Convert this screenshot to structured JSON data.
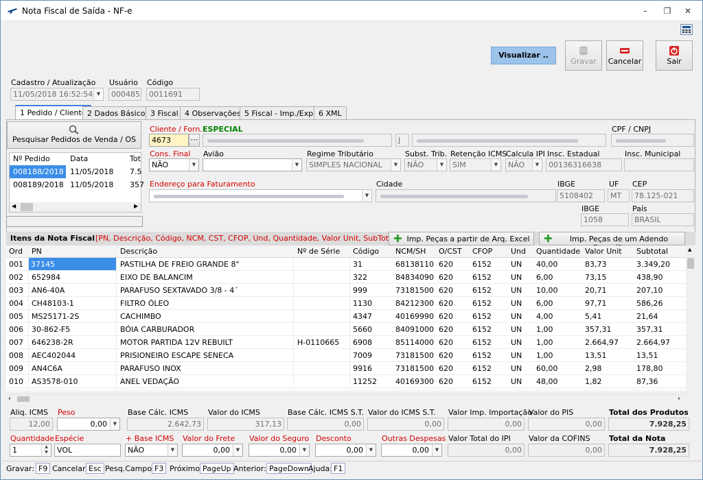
{
  "window": {
    "title": "Nota Fiscal de Saída - NF-e"
  },
  "toolbar": {
    "visualizar": "Visualizar ..",
    "gravar": "Gravar",
    "cancelar": "Cancelar",
    "sair": "Sair"
  },
  "header": {
    "cadastro_label": "Cadastro / Atualização",
    "cadastro_value": "11/05/2018 16:52:54",
    "usuario_label": "Usuário",
    "usuario_value": "0004855",
    "codigo_label": "Código",
    "codigo_value": "0011691"
  },
  "tabs": [
    "1 Pedido / Cliente",
    "2 Dados Básicos",
    "3 Fiscal",
    "4 Observações",
    "5 Fiscal - Imp./Exp.",
    "6 XML"
  ],
  "pedidos": {
    "search_label": "Pesquisar Pedidos de Venda / OS",
    "columns": [
      "Nº Pedido",
      "Data",
      "Tot"
    ],
    "rows": [
      [
        "008188/2018",
        "11/05/2018",
        "7.5"
      ],
      [
        "008189/2018",
        "11/05/2018",
        "357"
      ]
    ]
  },
  "cliente": {
    "cliente_label": "Cliente / Forn.",
    "especial": "ESPECIAL",
    "cliente_code": "4673",
    "uf_short": "J",
    "cpf_label": "CPF / CNPJ",
    "cons_final_label": "Cons. Final",
    "cons_final_value": "NÃO",
    "aviao_label": "Avião",
    "regime_label": "Regime Tributário",
    "regime_value": "SIMPLES NACIONAL",
    "subst_label": "Subst. Trib.",
    "subst_value": "NÃO",
    "retencao_label": "Retenção ICMS",
    "retencao_value": "SIM",
    "calcula_ipi_label": "Calcula IPI",
    "calcula_ipi_value": "NÃO",
    "insc_est_label": "Insc. Estadual",
    "insc_est_value": "00136316638",
    "insc_mun_label": "Insc. Municipal",
    "endereco_label": "Endereço para Faturamento",
    "cidade_label": "Cidade",
    "ibge_label": "IBGE",
    "ibge_value": "5108402",
    "uf_label": "UF",
    "uf_value": "MT",
    "cep_label": "CEP",
    "cep_value": "78.125-021",
    "ibge2_label": "IBGE",
    "ibge2_value": "1058",
    "pais_label": "País",
    "pais_value": "BRASIL"
  },
  "itens": {
    "title": "Itens da Nota Fiscal",
    "hint": "[PN, Descrição, Código, NCM, CST, CFOP, Und, Quantidade, Valor Unit, SubTotal]",
    "imp_excel": "Imp. Peças a partir de Arq. Excel",
    "imp_adendo": "Imp. Peças de um Adendo Específico",
    "columns": [
      "Ord",
      "PN",
      "Descrição",
      "Nº de Série",
      "Código",
      "NCM/SH",
      "O/CST",
      "CFOP",
      "Und",
      "Quantidade",
      "Valor Unit",
      "Subtotal"
    ],
    "rows": [
      [
        "001",
        "37145",
        "PASTILHA DE FREIO GRANDE 8\"",
        "",
        "31",
        "68138110",
        "620",
        "6152",
        "UN",
        "40,00",
        "83,73",
        "3.349,20"
      ],
      [
        "002",
        "652984",
        "EIXO DE  BALANCIM",
        "",
        "322",
        "84834090",
        "620",
        "6152",
        "UN",
        "6,00",
        "73,15",
        "438,90"
      ],
      [
        "003",
        "AN6-40A",
        "PARAFUSO SEXTAVADO 3/8 - 4´",
        "",
        "999",
        "73181500",
        "620",
        "6152",
        "UN",
        "10,00",
        "20,71",
        "207,10"
      ],
      [
        "004",
        "CH48103-1",
        "FILTRO ÓLEO",
        "",
        "1130",
        "84212300",
        "620",
        "6152",
        "UN",
        "6,00",
        "97,71",
        "586,26"
      ],
      [
        "005",
        "MS25171-2S",
        "CACHIMBO",
        "",
        "4347",
        "40169990",
        "620",
        "6152",
        "UN",
        "4,00",
        "5,41",
        "21,64"
      ],
      [
        "006",
        "30-862-F5",
        "BÓIA CARBURADOR",
        "",
        "5660",
        "84091000",
        "620",
        "6152",
        "UN",
        "1,00",
        "357,31",
        "357,31"
      ],
      [
        "007",
        "646238-2R",
        "MOTOR PARTIDA 12V REBUILT",
        "H-0110665",
        "6908",
        "85114000",
        "620",
        "6152",
        "UN",
        "1,00",
        "2.664,97",
        "2.664,97"
      ],
      [
        "008",
        "AEC402044",
        "PRISIONEIRO ESCAPE SENECA",
        "",
        "7009",
        "73181500",
        "620",
        "6152",
        "UN",
        "1,00",
        "13,51",
        "13,51"
      ],
      [
        "009",
        "AN4C6A",
        "PARAFUSO INOX",
        "",
        "9916",
        "73181500",
        "620",
        "6152",
        "UN",
        "60,00",
        "2,98",
        "178,80"
      ],
      [
        "010",
        "AS3578-010",
        "ANEL VEDAÇÃO",
        "",
        "11252",
        "40169300",
        "620",
        "6152",
        "UN",
        "48,00",
        "1,82",
        "87,36"
      ]
    ]
  },
  "totals": {
    "aliq_icms_label": "Aliq. ICMS",
    "aliq_icms": "12,00",
    "peso_label": "Peso",
    "peso": "0,00",
    "base_icms_label": "Base Cálc. ICMS",
    "base_icms": "2.642,73",
    "valor_icms_label": "Valor do ICMS",
    "valor_icms": "317,13",
    "base_st_label": "Base Cálc. ICMS S.T.",
    "base_st": "0,00",
    "valor_st_label": "Valor do ICMS S.T.",
    "valor_st": "0,00",
    "imp_label": "Valor Imp. Importação",
    "imp": "0,00",
    "pis_label": "Valor do PIS",
    "pis": "0,00",
    "total_prod_label": "Total dos Produtos",
    "total_prod": "7.928,25",
    "qtd_label": "Quantidade",
    "qtd": "1",
    "especie_label": "Espécie",
    "especie": "VOL",
    "base_icms2_label": "+ Base ICMS",
    "base_icms2": "NÃO",
    "frete_label": "Valor do Frete",
    "frete": "0,00",
    "seguro_label": "Valor do Seguro",
    "seguro": "0,00",
    "desconto_label": "Desconto",
    "desconto": "0,00",
    "outras_label": "Outras Despesas",
    "outras": "0,00",
    "ipi_label": "Valor Total do IPI",
    "ipi": "0,00",
    "cofins_label": "Valor da COFINS",
    "cofins": "0,00",
    "total_nota_label": "Total da Nota",
    "total_nota": "7.928,25"
  },
  "statusbar": [
    [
      "Gravar:",
      "F9"
    ],
    [
      "Cancelar:",
      "Esc"
    ],
    [
      "Pesq.Campo:",
      "F3"
    ],
    [
      "Próximo:",
      "PageUp"
    ],
    [
      "Anterior:",
      "PageDown"
    ],
    [
      "Ajuda:",
      "F1"
    ]
  ]
}
